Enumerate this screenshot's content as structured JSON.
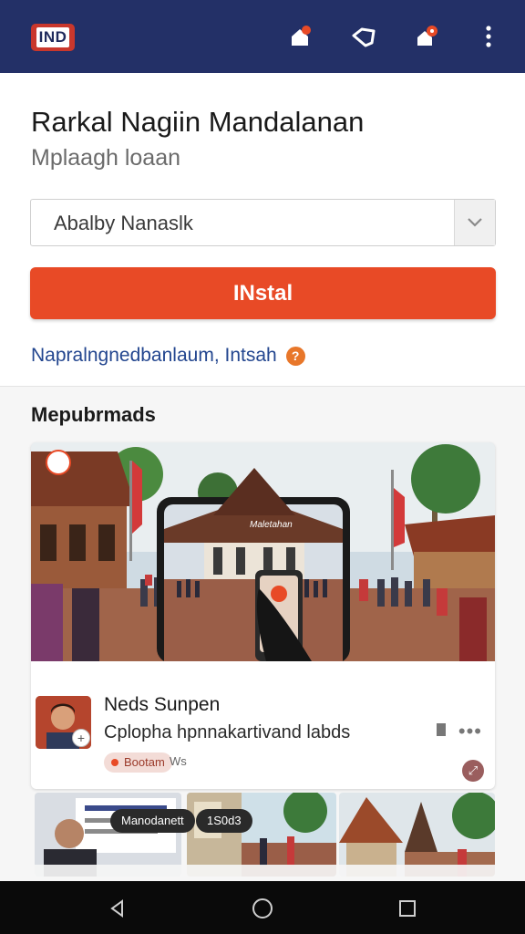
{
  "app": {
    "logo_text": "IND",
    "title": "Rarkal Nagiin Mandalanan",
    "subtitle": "Mplaagh loaan",
    "select_value": "Abalby Nanaslk",
    "install_label": "INstal",
    "info_text": "Napralngnedbanlaum, Intsah",
    "info_badge": "?"
  },
  "section": {
    "title": "Mepubrmads"
  },
  "feature": {
    "phone_caption": "Maletahan",
    "post_name": "Neds Sunpen",
    "post_desc": "Cplopha hpnnakartivand labds",
    "tag_label": "Bootam",
    "tag_extra": "Ws",
    "more_label": "•••"
  },
  "thumbs": {
    "chip_1": "Manodanett",
    "chip_2": "1S0d3"
  },
  "colors": {
    "appbar": "#233067",
    "accent": "#e84a26",
    "link": "#23468f"
  },
  "icons": {
    "appbar": [
      "home-alert-icon",
      "tag-icon",
      "notification-icon",
      "more-vert-icon"
    ],
    "system": [
      "back-icon",
      "home-icon",
      "recents-icon"
    ]
  }
}
